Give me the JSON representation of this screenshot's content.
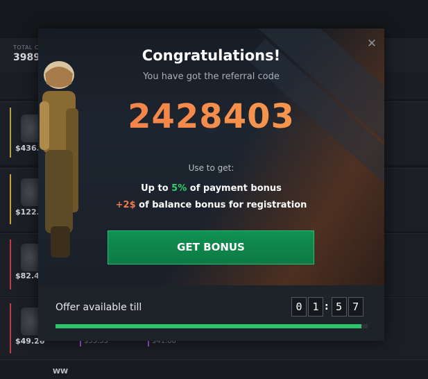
{
  "background": {
    "total_label": "TOTAL C",
    "total_value": "3989",
    "rows": [
      {
        "price": "$436.",
        "bar_color": "#b7a13a"
      },
      {
        "price": "$122.3",
        "bar_color": "#c8a23b"
      },
      {
        "price": "$82.4",
        "bar_color": "#c23b4a"
      },
      {
        "price": "$49.26",
        "bar_color": "#c23b4a",
        "mini_prices": [
          "$53.53",
          "$41.88"
        ]
      }
    ],
    "last_row_label": "WW"
  },
  "modal": {
    "title": "Congratulations!",
    "subtitle": "You have got the referral code",
    "code": "2428403",
    "use_to_get": "Use to get:",
    "benefit1": {
      "prefix": "Up to ",
      "highlight": "5%",
      "suffix": " of payment bonus"
    },
    "benefit2": {
      "highlight": "+2$",
      "suffix": " of balance bonus for registration"
    },
    "button_label": "GET BONUS",
    "close_icon": "close-icon",
    "offer_label": "Offer available till",
    "timer": {
      "d1": "0",
      "d2": "1",
      "d3": "5",
      "d4": "7"
    },
    "progress_fraction": 0.98,
    "colors": {
      "accent_green": "#2fd270",
      "accent_orange": "#f47a49",
      "button": "#109152"
    }
  }
}
